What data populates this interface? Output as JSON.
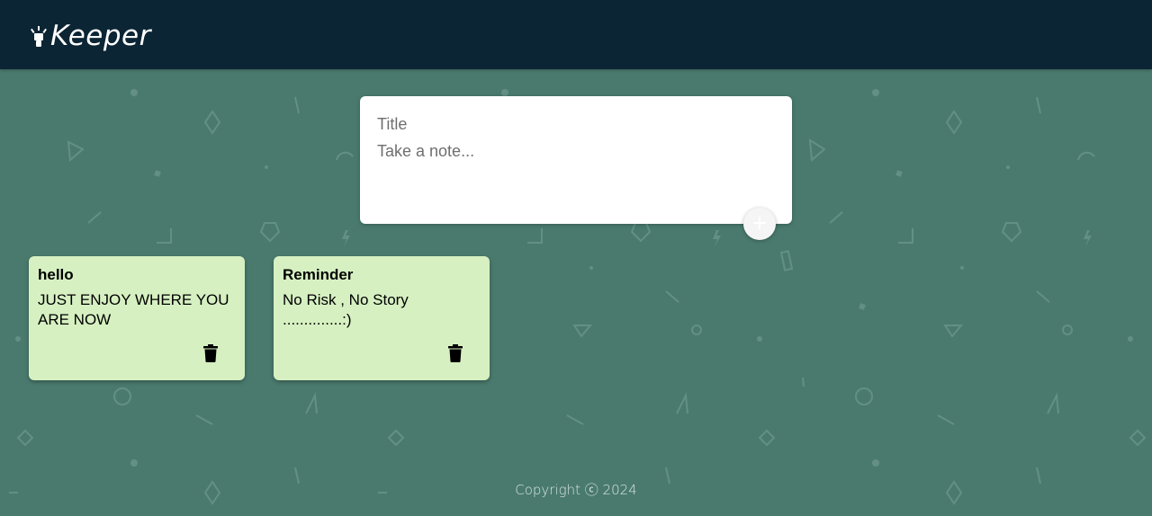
{
  "header": {
    "brand_name": "Keeper",
    "brand_icon": "lightbulb-icon"
  },
  "create_note": {
    "title_placeholder": "Title",
    "content_placeholder": "Take a note...",
    "add_icon": "plus-icon"
  },
  "notes": [
    {
      "title": "hello",
      "content": "JUST ENJOY WHERE YOU ARE NOW",
      "delete_icon": "trash-icon"
    },
    {
      "title": "Reminder",
      "content": "No Risk , No Story ..............:)",
      "delete_icon": "trash-icon"
    }
  ],
  "footer": {
    "copyright": "Copyright ⓒ 2024"
  },
  "colors": {
    "header_bg": "#0b2535",
    "page_bg": "#4a7a6e",
    "note_bg": "#d6f0c2",
    "card_bg": "#ffffff"
  }
}
